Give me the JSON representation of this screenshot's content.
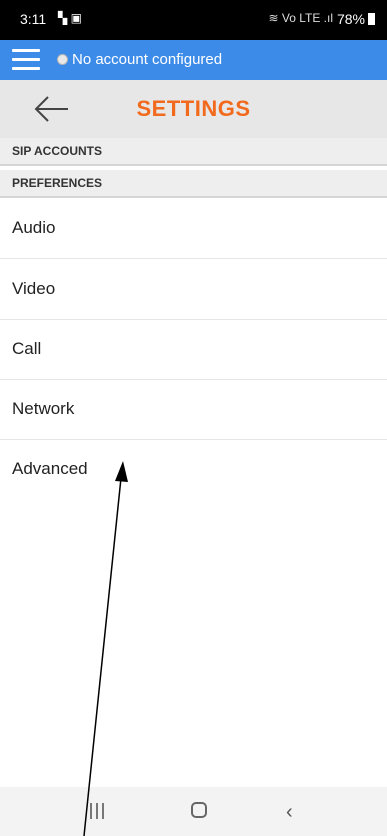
{
  "status_bar": {
    "time": "3:11",
    "left_icons": "▚ ▣",
    "right_icons": "≋ Vo LTE .ıl",
    "battery_percent": "78%"
  },
  "account_bar": {
    "status_text": "No account configured",
    "background_color": "#3d8be8"
  },
  "header": {
    "title": "SETTINGS",
    "title_color": "#f26a1d"
  },
  "sections": {
    "sip_accounts": "SIP ACCOUNTS",
    "preferences": "PREFERENCES"
  },
  "preferences_items": [
    {
      "label": "Audio"
    },
    {
      "label": "Video"
    },
    {
      "label": "Call"
    },
    {
      "label": "Network"
    },
    {
      "label": "Advanced"
    }
  ],
  "annotation": {
    "type": "arrow",
    "color": "#000000"
  }
}
